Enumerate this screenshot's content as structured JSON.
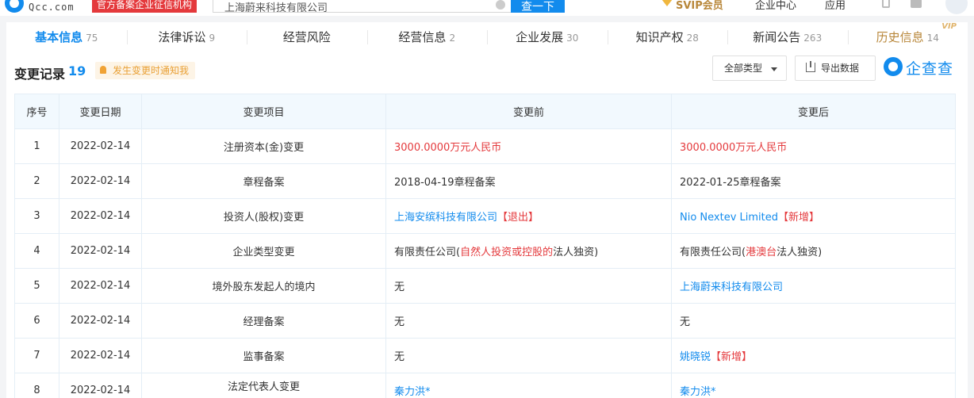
{
  "header": {
    "logo_text": "Qcc.com",
    "slogan": "官方备案企业征信机构",
    "search_value": "上海蔚来科技有限公司",
    "search_button": "查一下",
    "vip_label": "SVIP会员",
    "enterprise_label": "企业中心",
    "apps_label": "应用"
  },
  "tabs": [
    {
      "label": "基本信息",
      "count": "75",
      "active": true
    },
    {
      "label": "法律诉讼",
      "count": "9"
    },
    {
      "label": "经营风险",
      "count": ""
    },
    {
      "label": "经营信息",
      "count": "2"
    },
    {
      "label": "企业发展",
      "count": "30"
    },
    {
      "label": "知识产权",
      "count": "28"
    },
    {
      "label": "新闻公告",
      "count": "263"
    },
    {
      "label": "历史信息",
      "count": "14",
      "badge": "VIP"
    }
  ],
  "section": {
    "title": "变更记录",
    "count": "19",
    "notify": "发生变更时通知我",
    "type_filter": "全部类型",
    "export": "导出数据",
    "brand": "企查查"
  },
  "table": {
    "headers": [
      "序号",
      "变更日期",
      "变更项目",
      "变更前",
      "变更后"
    ],
    "rows": [
      {
        "no": "1",
        "date": "2022-02-14",
        "item": "注册资本(金)变更",
        "before": [
          {
            "t": "3000.0000万元人民币",
            "c": "red"
          }
        ],
        "after": [
          {
            "t": "3000.0000万元人民币",
            "c": "red"
          }
        ]
      },
      {
        "no": "2",
        "date": "2022-02-14",
        "item": "章程备案",
        "before": [
          {
            "t": "2018-04-19章程备案",
            "c": ""
          }
        ],
        "after": [
          {
            "t": "2022-01-25章程备案",
            "c": ""
          }
        ]
      },
      {
        "no": "3",
        "date": "2022-02-14",
        "item": "投资人(股权)变更",
        "before": [
          {
            "t": "上海安缤科技有限公司",
            "c": "blue"
          },
          {
            "t": "【退出】",
            "c": "red"
          }
        ],
        "after": [
          {
            "t": "Nio Nextev Limited",
            "c": "blue"
          },
          {
            "t": "【新增】",
            "c": "red"
          }
        ]
      },
      {
        "no": "4",
        "date": "2022-02-14",
        "item": "企业类型变更",
        "before": [
          {
            "t": "有限责任公司(",
            "c": ""
          },
          {
            "t": "自然人投资或控股的",
            "c": "red"
          },
          {
            "t": "法人独资)",
            "c": ""
          }
        ],
        "after": [
          {
            "t": "有限责任公司(",
            "c": ""
          },
          {
            "t": "港澳台",
            "c": "red"
          },
          {
            "t": "法人独资)",
            "c": ""
          }
        ]
      },
      {
        "no": "5",
        "date": "2022-02-14",
        "item": "境外股东发起人的境内",
        "before": [
          {
            "t": "无",
            "c": ""
          }
        ],
        "after": [
          {
            "t": "上海蔚来科技有限公司",
            "c": "blue"
          }
        ]
      },
      {
        "no": "6",
        "date": "2022-02-14",
        "item": "经理备案",
        "before": [
          {
            "t": "无",
            "c": ""
          }
        ],
        "after": [
          {
            "t": "无",
            "c": ""
          }
        ]
      },
      {
        "no": "7",
        "date": "2022-02-14",
        "item": "监事备案",
        "before": [
          {
            "t": "无",
            "c": ""
          }
        ],
        "after": [
          {
            "t": "姚晓锐",
            "c": "blue"
          },
          {
            "t": "【新增】",
            "c": "red"
          }
        ]
      },
      {
        "no": "8",
        "date": "2022-02-14",
        "item": "法定代表人变更",
        "before": [
          {
            "t": "秦力洪*",
            "c": "blue"
          }
        ],
        "after": [
          {
            "t": "秦力洪*",
            "c": "blue"
          }
        ]
      }
    ]
  },
  "colors": {
    "accent": "#128bed",
    "red": "#e4393c",
    "notify_text": "#e9a035",
    "vip_gold": "#b8873a"
  }
}
